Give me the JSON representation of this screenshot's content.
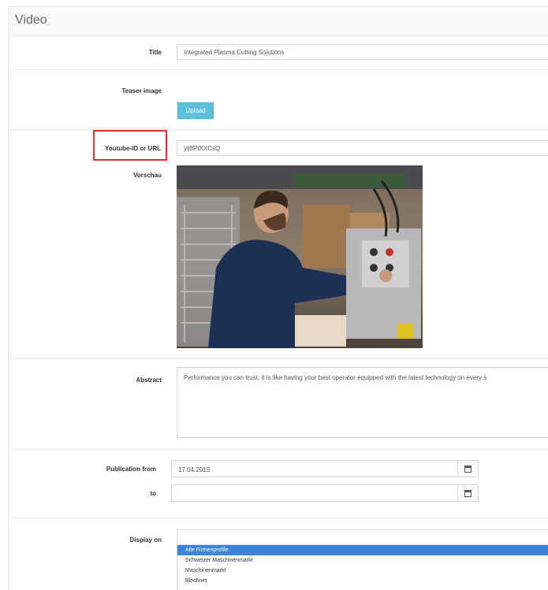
{
  "panel": {
    "title": "Video"
  },
  "fields": {
    "title": {
      "label": "Title",
      "value": "Integrated Plasma Cutting Solutions"
    },
    "teaser": {
      "label": "Teaser image",
      "upload_label": "Upload"
    },
    "youtube": {
      "label": "Youtube-ID or URL",
      "value": "ylj8PtXXCsQ"
    },
    "preview": {
      "label": "Vorschau"
    },
    "abstract": {
      "label": "Abstract",
      "value": "Performance you can trust. It is like having your best operator equipped with the latest technology on every s"
    },
    "publication_from": {
      "label": "Publication from",
      "value": "17.04.2019",
      "icon": "calendar-icon"
    },
    "publication_to": {
      "label": "to",
      "value": "",
      "icon": "calendar-icon"
    },
    "display_on": {
      "label": "Display on",
      "options": [
        {
          "label": "Alle Firmenprofile",
          "selected": true
        },
        {
          "label": "Schweizer Maschinenmarkt",
          "selected": false
        },
        {
          "label": "Maschinenmarkt",
          "selected": false
        },
        {
          "label": "Blechnet",
          "selected": false
        }
      ]
    }
  },
  "colors": {
    "highlight": "#e0303a",
    "upload_button": "#5bc0de",
    "selected_option": "#3b84d8"
  }
}
